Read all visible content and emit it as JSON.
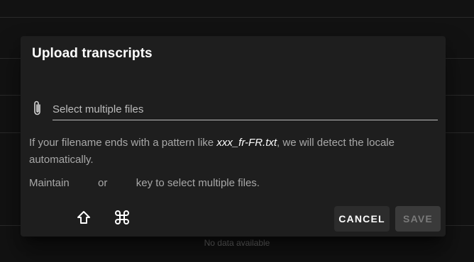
{
  "dialog": {
    "title": "Upload transcripts",
    "file_input": {
      "placeholder": "Select multiple files",
      "icon": "paperclip-icon"
    },
    "help": {
      "line1_prefix": "If your filename ends with a pattern like ",
      "line1_pattern": "xxx_fr-FR.txt",
      "line1_suffix": ", we will detect the locale automatically.",
      "line2_prefix": "Maintain ",
      "line2_or": " or ",
      "line2_suffix": " key to select multiple files.",
      "shift_icon": "shift-key-icon",
      "command_icon": "command-key-icon"
    },
    "actions": {
      "cancel_label": "CANCEL",
      "save_label": "SAVE",
      "save_disabled": true
    }
  },
  "background": {
    "empty_text": "No data available"
  },
  "colors": {
    "page_background": "#121212",
    "dialog_background": "#1e1e1e",
    "title_text": "#ffffff",
    "secondary_text": "#a8a8a8"
  }
}
